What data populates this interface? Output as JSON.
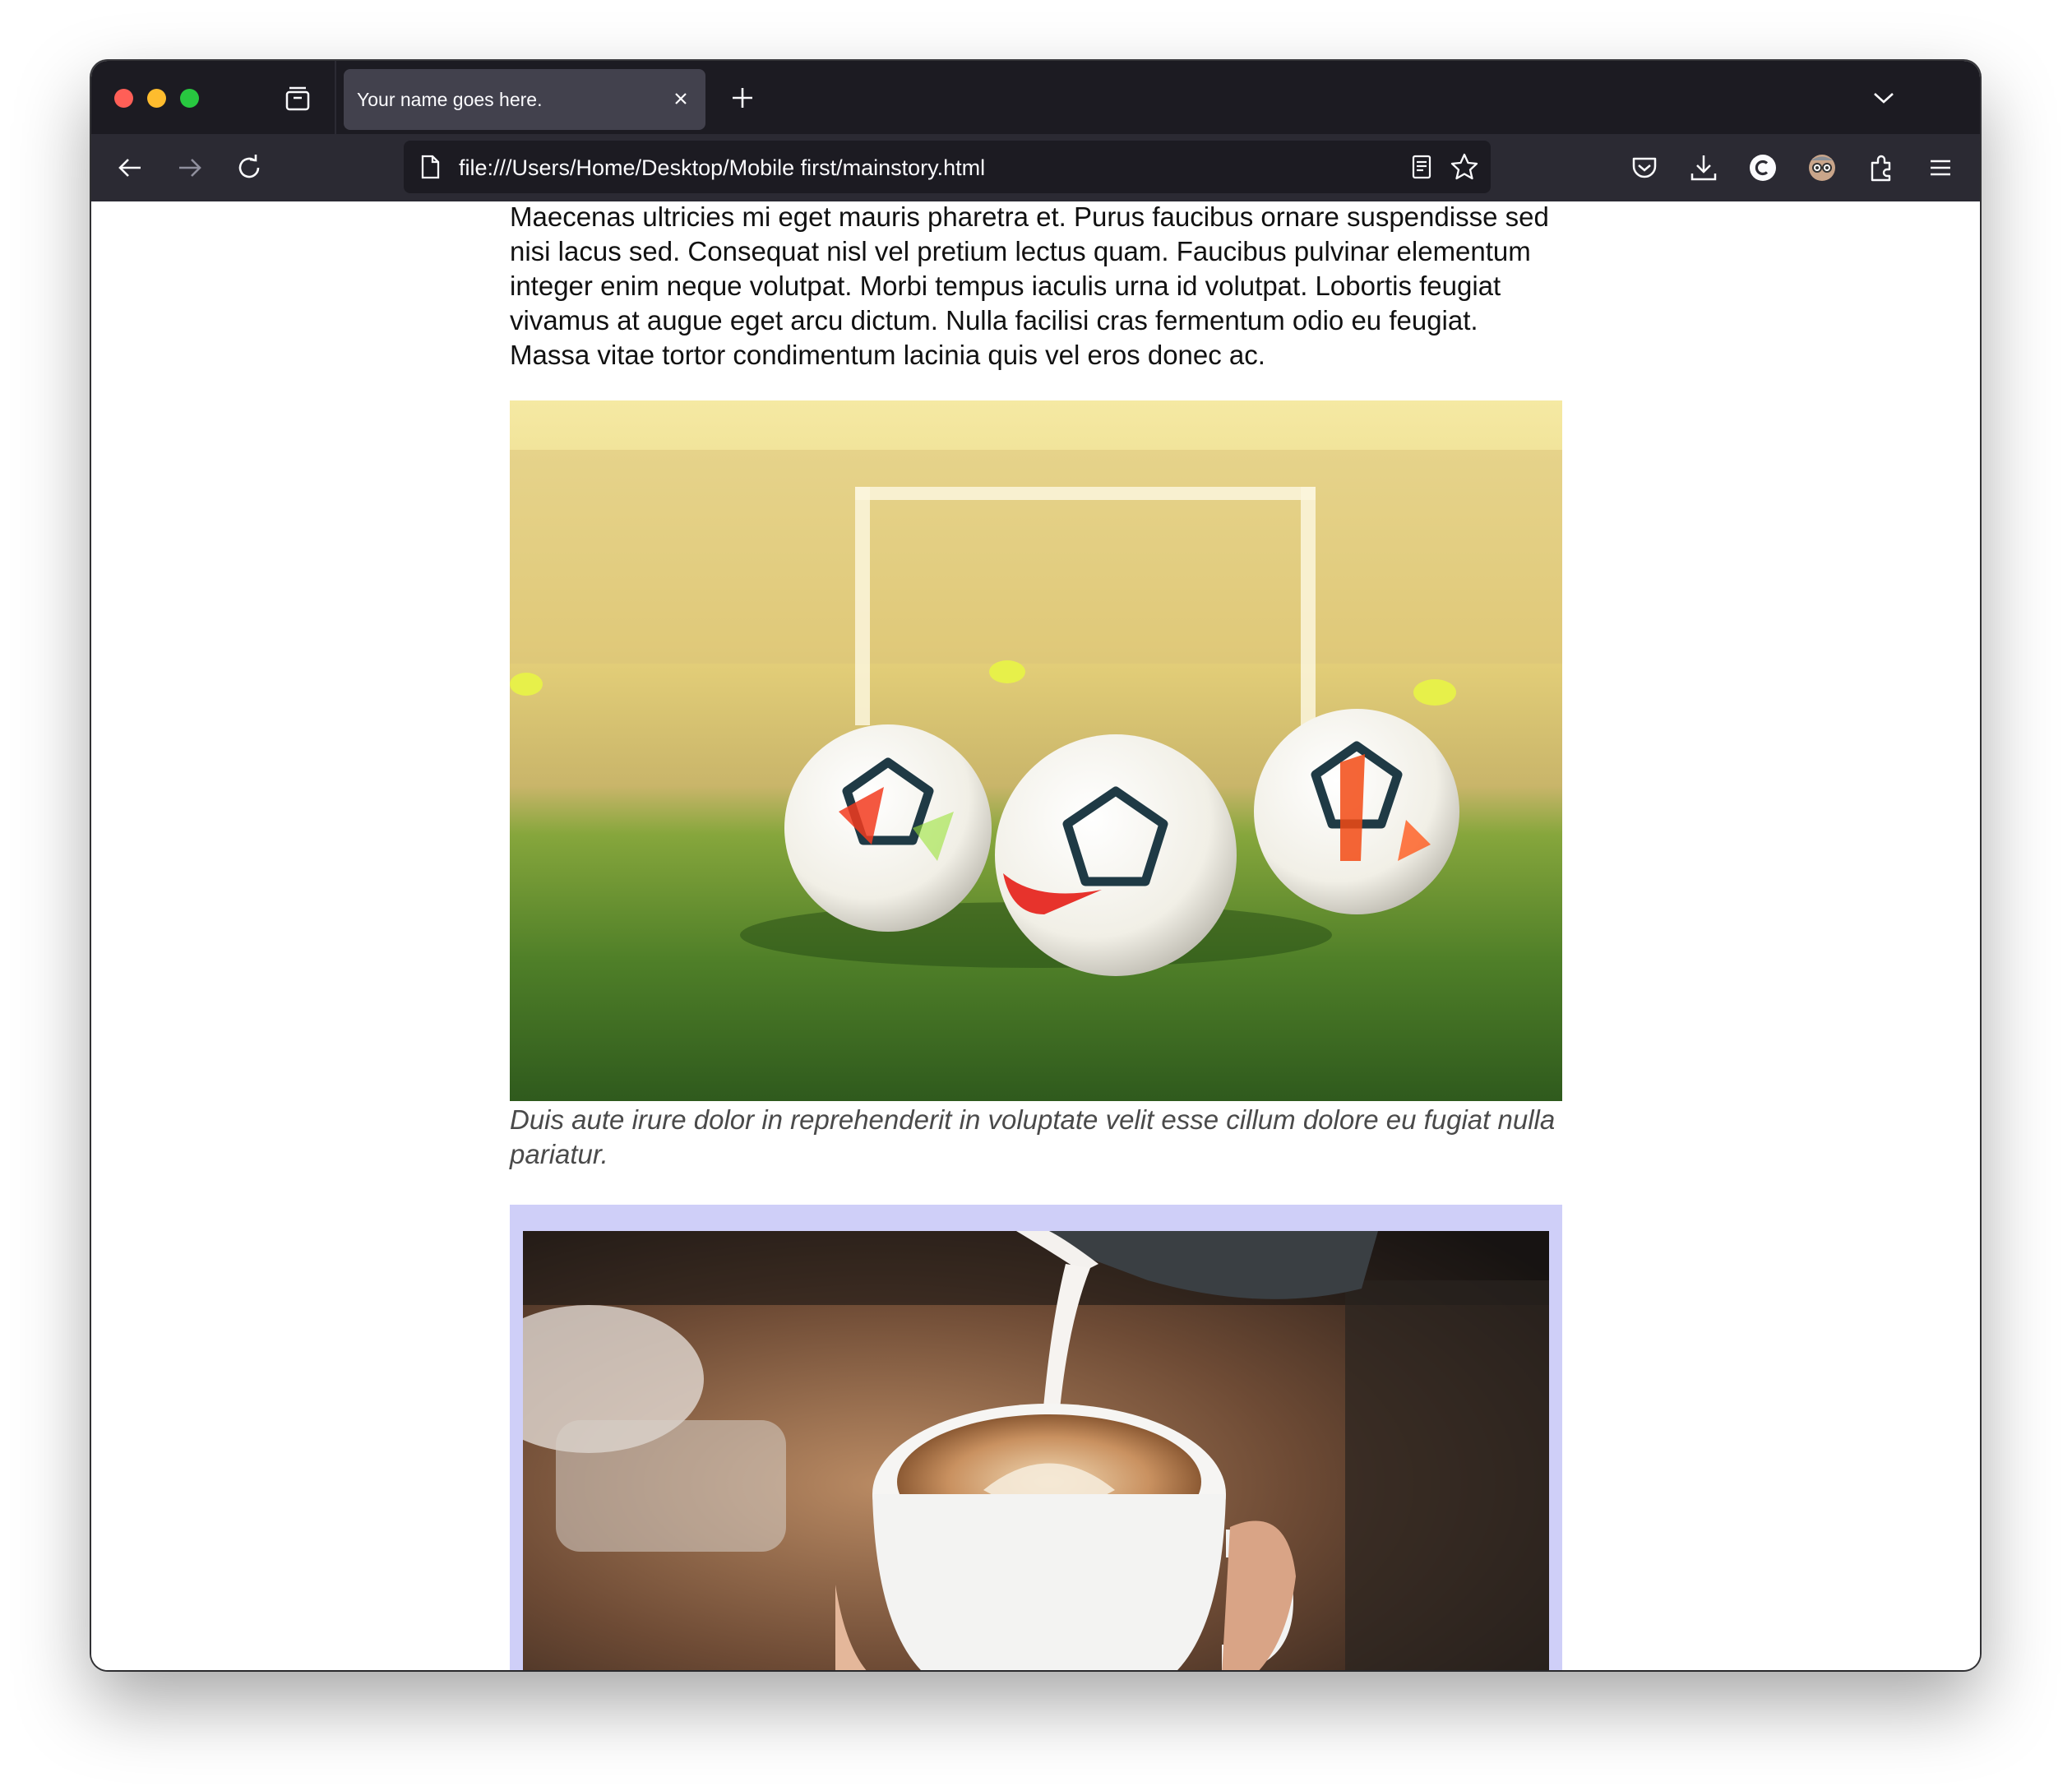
{
  "browser": {
    "tab_title": "Your name goes here.",
    "url": "file:///Users/Home/Desktop/Mobile first/mainstory.html"
  },
  "icons": {
    "tabs": "firefox-view-icon",
    "close_tab": "close-icon",
    "new_tab": "plus-icon",
    "list_tabs": "chevron-down-icon",
    "back": "back-arrow-icon",
    "forward": "forward-arrow-icon",
    "reload": "reload-icon",
    "page": "page-icon",
    "reader": "reader-view-icon",
    "bookmark": "star-icon",
    "pocket": "pocket-icon",
    "downloads": "download-icon",
    "extension_c": "c-extension-icon",
    "account": "account-avatar-icon",
    "extensions": "puzzle-icon",
    "menu": "hamburger-menu-icon"
  },
  "article": {
    "paragraph": "Maecenas ultricies mi eget mauris pharetra et. Purus faucibus ornare suspendisse sed nisi lacus sed. Consequat nisl vel pretium lectus quam. Faucibus pulvinar elementum integer enim neque volutpat. Morbi tempus iaculis urna id volutpat. Lobortis feugiat vivamus at augue eget arcu dictum. Nulla facilisi cras fermentum odio eu feugiat. Massa vitae tortor condimentum lacinia quis vel eros donec ac.",
    "figure1_caption": "Duis aute irure dolor in reprehenderit in voluptate velit esse cillum dolore eu fugiat nulla pariatur.",
    "figure2_frame_color": "#cfcff8"
  },
  "colors": {
    "chrome_dark": "#1c1b22",
    "toolbar": "#2b2a33",
    "active_tab": "#42414d"
  }
}
